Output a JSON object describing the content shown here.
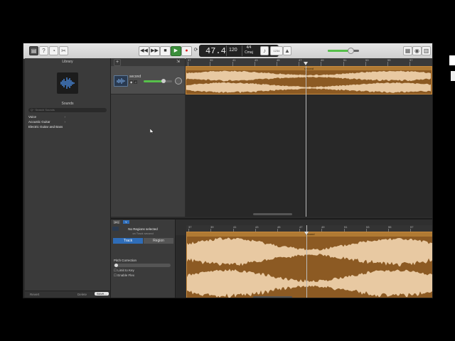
{
  "app": {
    "toolbar": {
      "left_buttons": [
        "library-icon",
        "help-icon",
        "smart-controls-icon",
        "editors-icon"
      ],
      "transport": [
        "rewind-icon",
        "fast-forward-icon",
        "stop-icon",
        "play-icon",
        "record-icon",
        "cycle-icon"
      ],
      "lcd": {
        "position": "47.4",
        "tempo": "120",
        "signature_top": "4/4",
        "signature_bottom": "Cmaj",
        "key": ""
      },
      "right_tools": [
        "tuner-icon",
        "count-in-label",
        "metronome-icon"
      ],
      "count_in_label": "1234",
      "master_volume": 0.72,
      "far_right": [
        "notepad-icon",
        "loop-browser-icon",
        "media-browser-icon"
      ]
    },
    "library": {
      "title": "Library",
      "sounds_title": "Sounds",
      "search_placeholder": "Q~ Search Sounds",
      "categories": [
        "Voice",
        "Acoustic Guitar",
        "Electric Guitar and Bass"
      ],
      "footer": {
        "revert": "Revert",
        "delete": "Delete",
        "save": "Save..."
      }
    },
    "tracks": {
      "add_button": "+",
      "track_name": "second",
      "volume": 0.7,
      "ruler": [
        "37",
        "39",
        "41",
        "43",
        "45",
        "47",
        "49",
        "51",
        "53",
        "55",
        "57"
      ],
      "region_name": "second",
      "playhead_bar": "47"
    },
    "editor": {
      "tabs": [
        "Track",
        "Region"
      ],
      "no_selection": "No Regions selected",
      "no_selection_sub": "on Track second",
      "pitch_correction": "Pitch Correction",
      "limit_to_key": "Limit to Key",
      "enable_flex": "Enable Flex",
      "ruler": [
        "37",
        "39",
        "41",
        "43",
        "45",
        "47",
        "49",
        "51",
        "53",
        "55",
        "57"
      ],
      "region_name": "second",
      "buttons": [
        "[m]",
        "Y"
      ]
    },
    "colors": {
      "region_fill": "#8c5a23",
      "wave": "#e8c9a2",
      "play_green": "#3b8f3b"
    }
  }
}
